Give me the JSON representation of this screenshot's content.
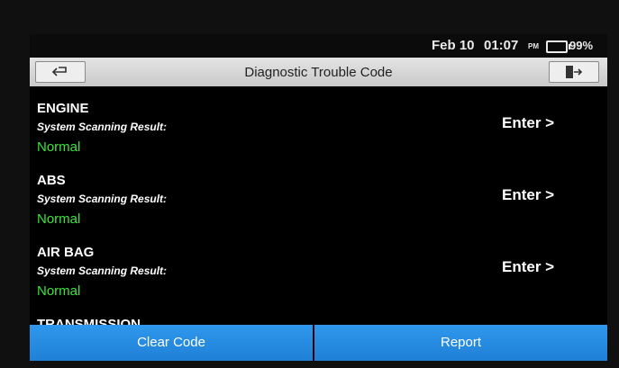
{
  "status_bar": {
    "date": "Feb 10",
    "time": "01:07",
    "ampm": "PM",
    "battery": "99%"
  },
  "header": {
    "title": "Diagnostic Trouble Code"
  },
  "systems": [
    {
      "name": "ENGINE",
      "subtitle": "System Scanning Result:",
      "result": "Normal",
      "action": "Enter >"
    },
    {
      "name": "ABS",
      "subtitle": "System Scanning Result:",
      "result": "Normal",
      "action": "Enter >"
    },
    {
      "name": "AIR BAG",
      "subtitle": "System Scanning Result:",
      "result": "Normal",
      "action": "Enter >"
    },
    {
      "name": "TRANSMISSION"
    }
  ],
  "footer": {
    "clear_label": "Clear Code",
    "report_label": "Report"
  },
  "colors": {
    "result_green": "#3de23d",
    "button_blue": "#2b8fe6",
    "titlebar_gray": "#d6d6d6"
  }
}
